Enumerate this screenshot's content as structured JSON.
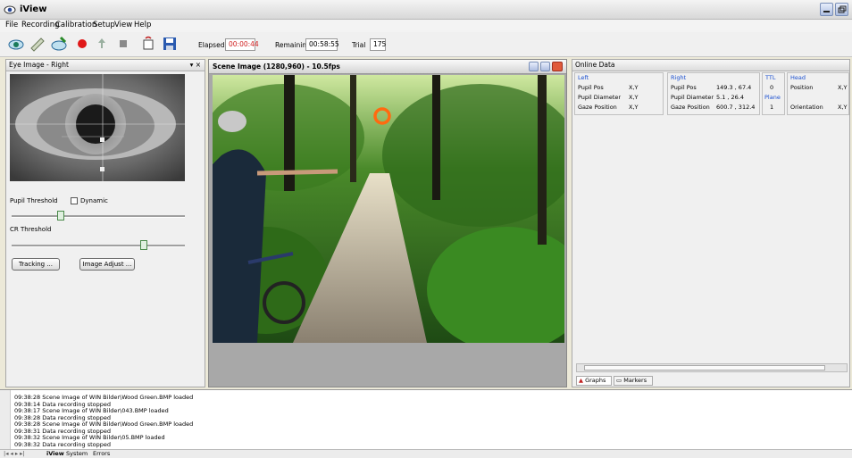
{
  "window": {
    "title": "iView"
  },
  "menu": [
    "File",
    "Recording",
    "Calibration",
    "Setup",
    "View",
    "Help"
  ],
  "toolbar": {
    "elapsed_label": "Elapsed",
    "elapsed_value": "00:00:44",
    "remaining_label": "Remaining",
    "remaining_value": "00:58:55",
    "trial_label": "Trial",
    "trial_value": "175",
    "record_color": "#e01818"
  },
  "eye_panel": {
    "title": "Eye Image - Right",
    "pupil_threshold_label": "Pupil Threshold",
    "dynamic_label": "Dynamic",
    "pupil_threshold_value": 0.28,
    "cr_threshold_label": "CR Threshold",
    "cr_threshold_value": 0.76,
    "tracking_button": "Tracking ...",
    "image_adjust_button": "Image Adjust ..."
  },
  "scene_window": {
    "title": "Scene Image (1280,960) - 10.5fps",
    "gaze_color": "#ff6a10"
  },
  "online_data": {
    "title": "Online Data",
    "left": {
      "header": "Left",
      "rows": [
        [
          "Pupil Pos",
          "X,Y"
        ],
        [
          "Pupil Diameter",
          "X,Y"
        ],
        [
          "Gaze Position",
          "X,Y"
        ]
      ]
    },
    "right": {
      "header": "Right",
      "rows": [
        [
          "Pupil Pos",
          "149.3 , 67.4"
        ],
        [
          "Pupil Diameter",
          "5.1 , 26.4"
        ],
        [
          "Gaze Position",
          "600.7 , 312.4"
        ]
      ]
    },
    "ttl": {
      "header": "TTL",
      "value": "0"
    },
    "plane": {
      "header": "Plane",
      "value": "1"
    },
    "head": {
      "header": "Head",
      "rows": [
        [
          "Position",
          "X,Y"
        ],
        [
          "Orientation",
          "X,Y"
        ]
      ]
    },
    "tabs": [
      "Graphs",
      "Markers"
    ]
  },
  "log": {
    "lines": [
      "09:38:28  Scene Image of WIN Bilder\\Wood Green.BMP loaded",
      "09:38:14  Data recording stopped",
      "09:38:17  Scene Image of WIN Bilder\\043.BMP loaded",
      "09:38:28  Data recording stopped",
      "09:38:28  Scene Image of WIN Bilder\\Wood Green.BMP loaded",
      "09:38:31  Data recording stopped",
      "09:38:32  Scene Image of WIN Bilder\\05.BMP loaded",
      "09:38:32  Data recording stopped"
    ],
    "tabs": [
      "iView",
      "System",
      "Errors"
    ]
  }
}
